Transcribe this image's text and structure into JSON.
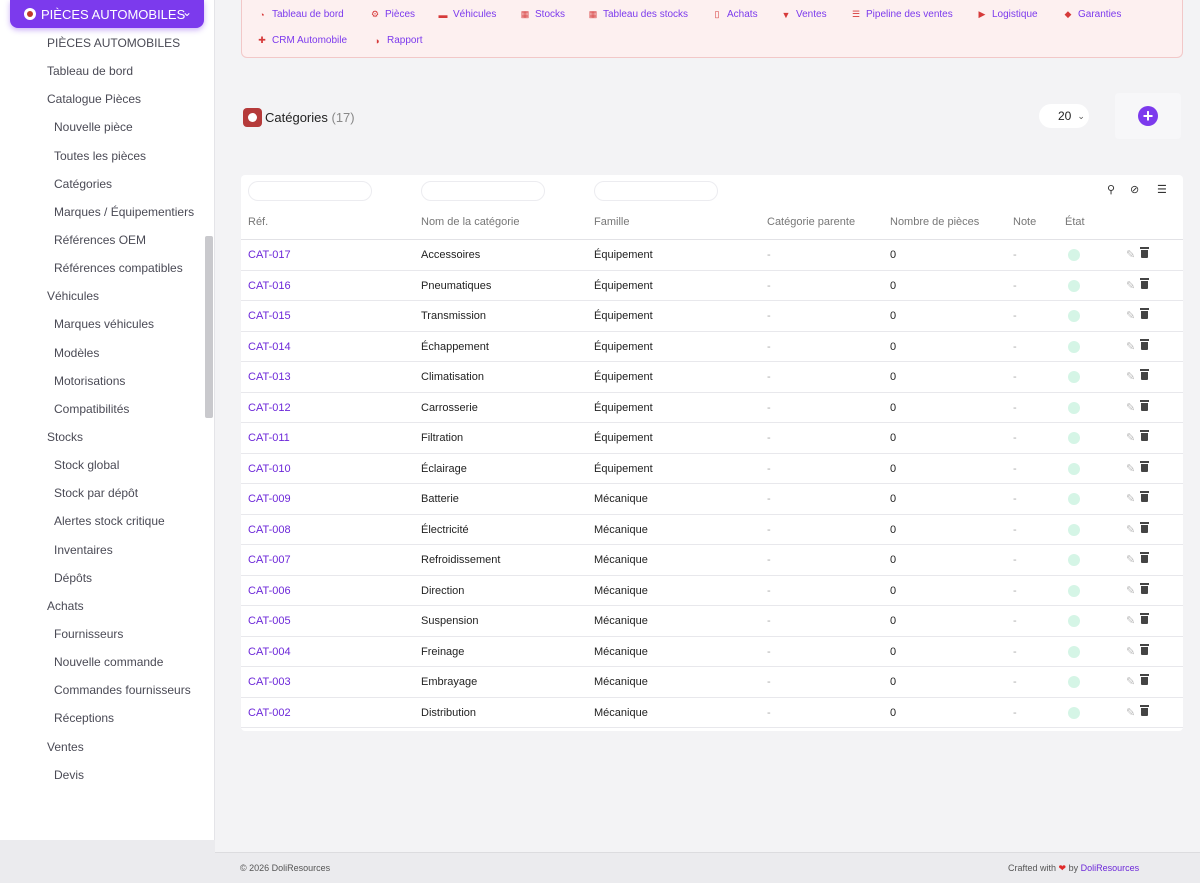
{
  "module": {
    "label": "PIÈCES AUTOMOBILES"
  },
  "sidebar": {
    "items": [
      {
        "label": "PIÈCES AUTOMOBILES",
        "level": 0
      },
      {
        "label": "Tableau de bord",
        "level": 0
      },
      {
        "label": "Catalogue Pièces",
        "level": 0
      },
      {
        "label": "Nouvelle pièce",
        "level": 1
      },
      {
        "label": "Toutes les pièces",
        "level": 1
      },
      {
        "label": "Catégories",
        "level": 1
      },
      {
        "label": "Marques / Équipementiers",
        "level": 1
      },
      {
        "label": "Références OEM",
        "level": 1
      },
      {
        "label": "Références compatibles",
        "level": 1
      },
      {
        "label": "Véhicules",
        "level": 0
      },
      {
        "label": "Marques véhicules",
        "level": 1
      },
      {
        "label": "Modèles",
        "level": 1
      },
      {
        "label": "Motorisations",
        "level": 1
      },
      {
        "label": "Compatibilités",
        "level": 1
      },
      {
        "label": "Stocks",
        "level": 0
      },
      {
        "label": "Stock global",
        "level": 1
      },
      {
        "label": "Stock par dépôt",
        "level": 1
      },
      {
        "label": "Alertes stock critique",
        "level": 1
      },
      {
        "label": "Inventaires",
        "level": 1
      },
      {
        "label": "Dépôts",
        "level": 1
      },
      {
        "label": "Achats",
        "level": 0
      },
      {
        "label": "Fournisseurs",
        "level": 1
      },
      {
        "label": "Nouvelle commande",
        "level": 1
      },
      {
        "label": "Commandes fournisseurs",
        "level": 1
      },
      {
        "label": "Réceptions",
        "level": 1
      },
      {
        "label": "Ventes",
        "level": 0
      },
      {
        "label": "Devis",
        "level": 1
      }
    ]
  },
  "topnav": {
    "items": [
      {
        "label": "Tableau de bord",
        "icon": "dashboard-icon"
      },
      {
        "label": "Pièces",
        "icon": "gear-icon"
      },
      {
        "label": "Véhicules",
        "icon": "car-icon"
      },
      {
        "label": "Stocks",
        "icon": "boxes-icon"
      },
      {
        "label": "Tableau des stocks",
        "icon": "grid-icon"
      },
      {
        "label": "Achats",
        "icon": "document-icon"
      },
      {
        "label": "Ventes",
        "icon": "cart-icon"
      },
      {
        "label": "Pipeline des ventes",
        "icon": "bars-icon"
      },
      {
        "label": "Logistique",
        "icon": "truck-icon"
      },
      {
        "label": "Garanties",
        "icon": "shield-icon"
      },
      {
        "label": "CRM Automobile",
        "icon": "user-plus-icon"
      },
      {
        "label": "Rapport",
        "icon": "pie-chart-icon"
      }
    ]
  },
  "page": {
    "title": "Catégories",
    "count": "(17)",
    "limit": "20"
  },
  "table": {
    "columns": [
      "Réf.",
      "Nom de la catégorie",
      "Famille",
      "Catégorie parente",
      "Nombre de pièces",
      "Note",
      "État"
    ],
    "rows": [
      {
        "ref": "CAT-017",
        "name": "Accessoires",
        "family": "Équipement",
        "parent": "-",
        "count": "0",
        "note": "-"
      },
      {
        "ref": "CAT-016",
        "name": "Pneumatiques",
        "family": "Équipement",
        "parent": "-",
        "count": "0",
        "note": "-"
      },
      {
        "ref": "CAT-015",
        "name": "Transmission",
        "family": "Équipement",
        "parent": "-",
        "count": "0",
        "note": "-"
      },
      {
        "ref": "CAT-014",
        "name": "Échappement",
        "family": "Équipement",
        "parent": "-",
        "count": "0",
        "note": "-"
      },
      {
        "ref": "CAT-013",
        "name": "Climatisation",
        "family": "Équipement",
        "parent": "-",
        "count": "0",
        "note": "-"
      },
      {
        "ref": "CAT-012",
        "name": "Carrosserie",
        "family": "Équipement",
        "parent": "-",
        "count": "0",
        "note": "-"
      },
      {
        "ref": "CAT-011",
        "name": "Filtration",
        "family": "Équipement",
        "parent": "-",
        "count": "0",
        "note": "-"
      },
      {
        "ref": "CAT-010",
        "name": "Éclairage",
        "family": "Équipement",
        "parent": "-",
        "count": "0",
        "note": "-"
      },
      {
        "ref": "CAT-009",
        "name": "Batterie",
        "family": "Mécanique",
        "parent": "-",
        "count": "0",
        "note": "-"
      },
      {
        "ref": "CAT-008",
        "name": "Électricité",
        "family": "Mécanique",
        "parent": "-",
        "count": "0",
        "note": "-"
      },
      {
        "ref": "CAT-007",
        "name": "Refroidissement",
        "family": "Mécanique",
        "parent": "-",
        "count": "0",
        "note": "-"
      },
      {
        "ref": "CAT-006",
        "name": "Direction",
        "family": "Mécanique",
        "parent": "-",
        "count": "0",
        "note": "-"
      },
      {
        "ref": "CAT-005",
        "name": "Suspension",
        "family": "Mécanique",
        "parent": "-",
        "count": "0",
        "note": "-"
      },
      {
        "ref": "CAT-004",
        "name": "Freinage",
        "family": "Mécanique",
        "parent": "-",
        "count": "0",
        "note": "-"
      },
      {
        "ref": "CAT-003",
        "name": "Embrayage",
        "family": "Mécanique",
        "parent": "-",
        "count": "0",
        "note": "-"
      },
      {
        "ref": "CAT-002",
        "name": "Distribution",
        "family": "Mécanique",
        "parent": "-",
        "count": "0",
        "note": "-"
      }
    ]
  },
  "footer": {
    "copyright": "© 2026 DoliResources",
    "crafted_prefix": "Crafted with",
    "heart": "❤",
    "crafted_by": "by",
    "brand": "DoliResources"
  },
  "colors": {
    "accent": "#7c3aed",
    "nav_icon": "#d63a3a",
    "status_on": "#d5f5e6"
  }
}
